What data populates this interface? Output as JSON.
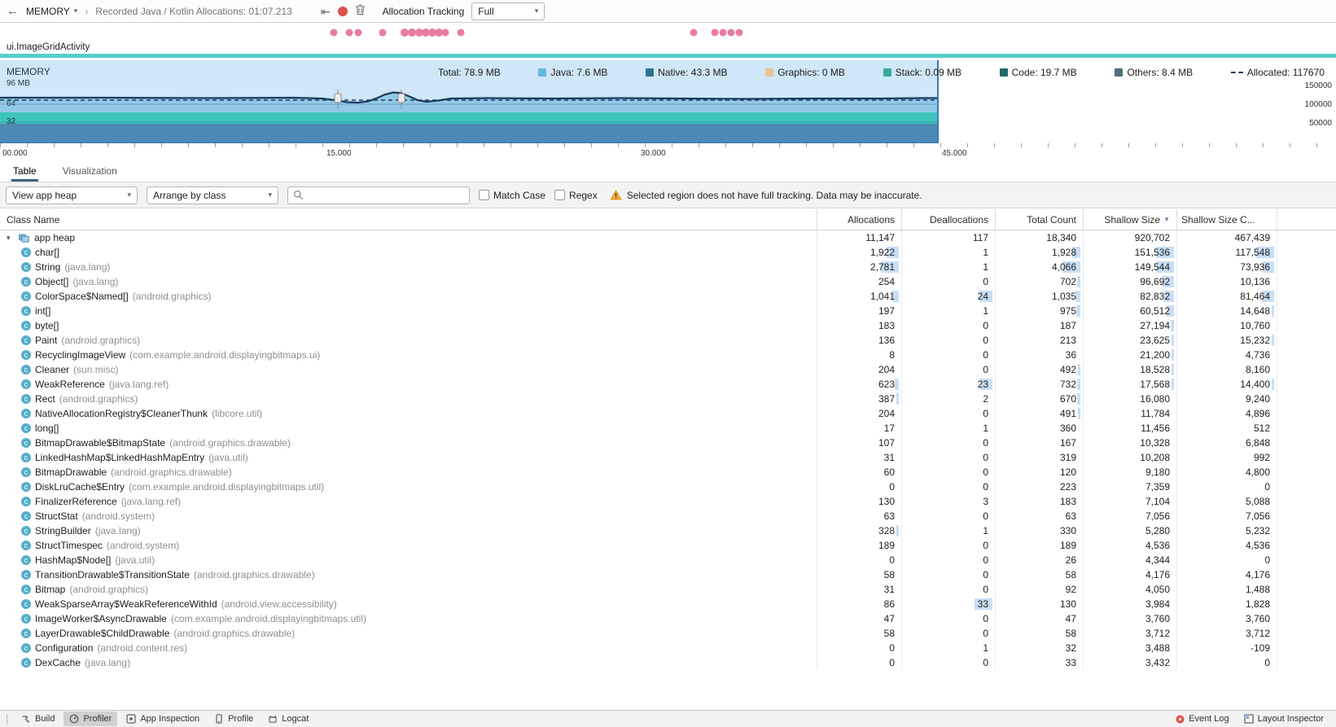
{
  "icons": {
    "back": "←",
    "caret_down": "▾",
    "chevron_right": "›",
    "export": "⇤",
    "sort_desc": "▼"
  },
  "toolbar": {
    "view_label": "MEMORY",
    "session_title": "Recorded Java / Kotlin Allocations: 01:07.213",
    "tracking_label": "Allocation Tracking",
    "tracking_value": "Full"
  },
  "events": {
    "dots": [
      [
        410,
        9
      ],
      [
        429,
        9
      ],
      [
        440,
        9
      ],
      [
        470,
        9
      ],
      [
        497,
        10
      ],
      [
        506,
        10
      ],
      [
        515,
        10
      ],
      [
        523,
        10
      ],
      [
        531,
        10
      ],
      [
        539,
        10
      ],
      [
        547,
        9
      ],
      [
        566,
        9
      ],
      [
        852,
        9
      ],
      [
        878,
        9
      ],
      [
        888,
        9
      ],
      [
        898,
        9
      ],
      [
        908,
        9
      ]
    ],
    "color": "#e87d9f"
  },
  "activity": {
    "label": "ui.ImageGridActivity"
  },
  "chart": {
    "title": "MEMORY",
    "legend": [
      {
        "label": "Total: 78.9 MB",
        "swatch": "none",
        "color": ""
      },
      {
        "label": "Java: 7.6 MB",
        "swatch": "square",
        "color": "#68b6e2"
      },
      {
        "label": "Native: 43.3 MB",
        "swatch": "square",
        "color": "#36708f"
      },
      {
        "label": "Graphics: 0 MB",
        "swatch": "square",
        "color": "#e7c38a"
      },
      {
        "label": "Stack: 0.09 MB",
        "swatch": "square",
        "color": "#3aa8a2"
      },
      {
        "label": "Code: 19.7 MB",
        "swatch": "square",
        "color": "#1e6b6b"
      },
      {
        "label": "Others: 8.4 MB",
        "swatch": "square",
        "color": "#50707d"
      },
      {
        "label": "Allocated: 117670",
        "swatch": "dash",
        "color": "#1c3a5e"
      }
    ],
    "left_axis": [
      "96 MB",
      "64",
      "32"
    ],
    "right_axis": [
      "150000",
      "100000",
      "50000"
    ],
    "time_axis": [
      "00.000",
      "15.000",
      "30.000",
      "45.000"
    ]
  },
  "tabs": [
    "Table",
    "Visualization"
  ],
  "filters": {
    "heap": "View app heap",
    "arrange": "Arrange by class",
    "search_placeholder": "",
    "match_case": "Match Case",
    "regex": "Regex",
    "warning": "Selected region does not have full tracking. Data may be inaccurate."
  },
  "table": {
    "columns": [
      "Class Name",
      "Allocations",
      "Deallocations",
      "Total Count",
      "Shallow Size",
      "Shallow Size C..."
    ],
    "rows": [
      {
        "root": true,
        "name": "app heap",
        "pkg": "",
        "values": [
          "11,147",
          "117",
          "18,340",
          "920,702",
          "467,439"
        ]
      },
      {
        "root": false,
        "name": "char[]",
        "pkg": "",
        "values": [
          "1,922",
          "1",
          "1,928",
          "151,536",
          "117,548"
        ]
      },
      {
        "root": false,
        "name": "String",
        "pkg": "(java.lang)",
        "values": [
          "2,781",
          "1",
          "4,066",
          "149,544",
          "73,936"
        ]
      },
      {
        "root": false,
        "name": "Object[]",
        "pkg": "(java.lang)",
        "values": [
          "254",
          "0",
          "702",
          "96,692",
          "10,136"
        ]
      },
      {
        "root": false,
        "name": "ColorSpace$Named[]",
        "pkg": "(android.graphics)",
        "values": [
          "1,041",
          "24",
          "1,035",
          "82,832",
          "81,464"
        ]
      },
      {
        "root": false,
        "name": "int[]",
        "pkg": "",
        "values": [
          "197",
          "1",
          "975",
          "60,512",
          "14,648"
        ]
      },
      {
        "root": false,
        "name": "byte[]",
        "pkg": "",
        "values": [
          "183",
          "0",
          "187",
          "27,194",
          "10,760"
        ]
      },
      {
        "root": false,
        "name": "Paint",
        "pkg": "(android.graphics)",
        "values": [
          "136",
          "0",
          "213",
          "23,625",
          "15,232"
        ]
      },
      {
        "root": false,
        "name": "RecyclingImageView",
        "pkg": "(com.example.android.displayingbitmaps.ui)",
        "values": [
          "8",
          "0",
          "36",
          "21,200",
          "4,736"
        ]
      },
      {
        "root": false,
        "name": "Cleaner",
        "pkg": "(sun.misc)",
        "values": [
          "204",
          "0",
          "492",
          "18,528",
          "8,160"
        ]
      },
      {
        "root": false,
        "name": "WeakReference",
        "pkg": "(java.lang.ref)",
        "values": [
          "623",
          "23",
          "732",
          "17,568",
          "14,400"
        ]
      },
      {
        "root": false,
        "name": "Rect",
        "pkg": "(android.graphics)",
        "values": [
          "387",
          "2",
          "670",
          "16,080",
          "9,240"
        ]
      },
      {
        "root": false,
        "name": "NativeAllocationRegistry$CleanerThunk",
        "pkg": "(libcore.util)",
        "values": [
          "204",
          "0",
          "491",
          "11,784",
          "4,896"
        ]
      },
      {
        "root": false,
        "name": "long[]",
        "pkg": "",
        "values": [
          "17",
          "1",
          "360",
          "11,456",
          "512"
        ]
      },
      {
        "root": false,
        "name": "BitmapDrawable$BitmapState",
        "pkg": "(android.graphics.drawable)",
        "values": [
          "107",
          "0",
          "167",
          "10,328",
          "6,848"
        ]
      },
      {
        "root": false,
        "name": "LinkedHashMap$LinkedHashMapEntry",
        "pkg": "(java.util)",
        "values": [
          "31",
          "0",
          "319",
          "10,208",
          "992"
        ]
      },
      {
        "root": false,
        "name": "BitmapDrawable",
        "pkg": "(android.graphics.drawable)",
        "values": [
          "60",
          "0",
          "120",
          "9,180",
          "4,800"
        ]
      },
      {
        "root": false,
        "name": "DiskLruCache$Entry",
        "pkg": "(com.example.android.displayingbitmaps.util)",
        "values": [
          "0",
          "0",
          "223",
          "7,359",
          "0"
        ]
      },
      {
        "root": false,
        "name": "FinalizerReference",
        "pkg": "(java.lang.ref)",
        "values": [
          "130",
          "3",
          "183",
          "7,104",
          "5,088"
        ]
      },
      {
        "root": false,
        "name": "StructStat",
        "pkg": "(android.system)",
        "values": [
          "63",
          "0",
          "63",
          "7,056",
          "7,056"
        ]
      },
      {
        "root": false,
        "name": "StringBuilder",
        "pkg": "(java.lang)",
        "values": [
          "328",
          "1",
          "330",
          "5,280",
          "5,232"
        ]
      },
      {
        "root": false,
        "name": "StructTimespec",
        "pkg": "(android.system)",
        "values": [
          "189",
          "0",
          "189",
          "4,536",
          "4,536"
        ]
      },
      {
        "root": false,
        "name": "HashMap$Node[]",
        "pkg": "(java.util)",
        "values": [
          "0",
          "0",
          "26",
          "4,344",
          "0"
        ]
      },
      {
        "root": false,
        "name": "TransitionDrawable$TransitionState",
        "pkg": "(android.graphics.drawable)",
        "values": [
          "58",
          "0",
          "58",
          "4,176",
          "4,176"
        ]
      },
      {
        "root": false,
        "name": "Bitmap",
        "pkg": "(android.graphics)",
        "values": [
          "31",
          "0",
          "92",
          "4,050",
          "1,488"
        ]
      },
      {
        "root": false,
        "name": "WeakSparseArray$WeakReferenceWithId",
        "pkg": "(android.view.accessibility)",
        "values": [
          "86",
          "33",
          "130",
          "3,984",
          "1,828"
        ]
      },
      {
        "root": false,
        "name": "ImageWorker$AsyncDrawable",
        "pkg": "(com.example.android.displayingbitmaps.util)",
        "values": [
          "47",
          "0",
          "47",
          "3,760",
          "3,760"
        ]
      },
      {
        "root": false,
        "name": "LayerDrawable$ChildDrawable",
        "pkg": "(android.graphics.drawable)",
        "values": [
          "58",
          "0",
          "58",
          "3,712",
          "3,712"
        ]
      },
      {
        "root": false,
        "name": "Configuration",
        "pkg": "(android.content.res)",
        "values": [
          "0",
          "1",
          "32",
          "3,488",
          "-109"
        ]
      },
      {
        "root": false,
        "name": "DexCache",
        "pkg": "(java.lang)",
        "values": [
          "0",
          "0",
          "33",
          "3,432",
          "0"
        ]
      }
    ]
  },
  "statusbar": {
    "left": [
      {
        "label": "Build"
      },
      {
        "label": "Profiler",
        "active": true
      },
      {
        "label": "App Inspection"
      },
      {
        "label": "Profile"
      },
      {
        "label": "Logcat"
      }
    ],
    "right": [
      {
        "label": "Event Log"
      },
      {
        "label": "Layout Inspector"
      }
    ]
  }
}
